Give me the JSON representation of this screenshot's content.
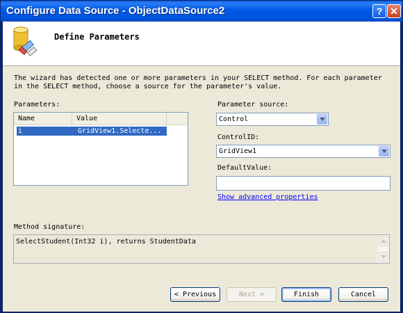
{
  "window": {
    "title": "Configure Data Source - ObjectDataSource2"
  },
  "titlebar": {
    "help_label": "?",
    "close_label": "✕"
  },
  "header": {
    "title": "Define Parameters",
    "icon": "database-wizard-icon"
  },
  "description": "The wizard has detected one or more parameters in your SELECT method. For each parameter in the SELECT method, choose a source for the parameter's value.",
  "parameters": {
    "label": "Parameters:",
    "columns": [
      "Name",
      "Value"
    ],
    "rows": [
      {
        "name": "i",
        "value": "GridView1.Selecte..."
      }
    ]
  },
  "parameter_source": {
    "label": "Parameter source:",
    "value": "Control"
  },
  "control_id": {
    "label": "ControlID:",
    "value": "GridView1"
  },
  "default_value": {
    "label": "DefaultValue:",
    "value": ""
  },
  "advanced_link": "Show advanced properties",
  "method_signature": {
    "label": "Method signature:",
    "value": "SelectStudent(Int32 i), returns StudentData"
  },
  "buttons": {
    "previous": "Previous",
    "next": "Next",
    "finish": "Finish",
    "cancel": "Cancel"
  }
}
